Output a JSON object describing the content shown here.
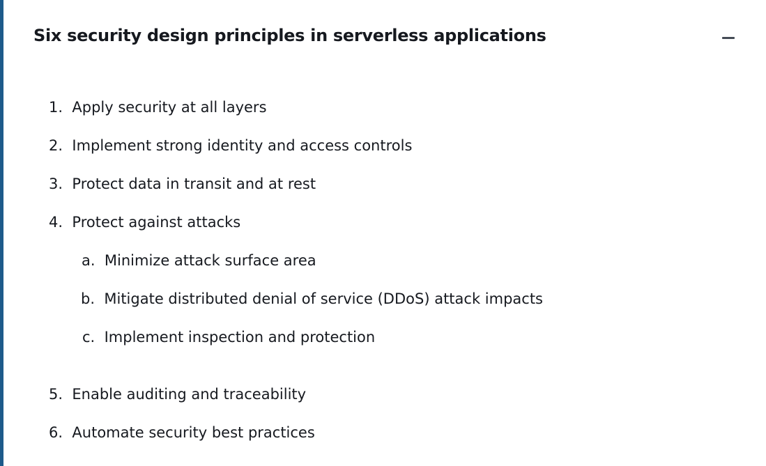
{
  "panel": {
    "title": "Six security design principles in serverless applications",
    "collapse_icon": "minus-icon"
  },
  "principles": [
    {
      "marker": "1.",
      "text": "Apply security at all layers"
    },
    {
      "marker": "2.",
      "text": "Implement strong identity and access controls"
    },
    {
      "marker": "3.",
      "text": "Protect data in transit and at rest"
    },
    {
      "marker": "4.",
      "text": "Protect against attacks"
    },
    {
      "marker": "5.",
      "text": "Enable auditing and traceability"
    },
    {
      "marker": "6.",
      "text": "Automate security best practices"
    }
  ],
  "sub_principles": [
    {
      "marker": "a.",
      "text": "Minimize attack surface area"
    },
    {
      "marker": "b.",
      "text": "Mitigate distributed denial of service (DDoS) attack impacts"
    },
    {
      "marker": "c.",
      "text": "Implement inspection and protection"
    }
  ],
  "colors": {
    "accent": "#1d5a8a",
    "text": "#16191f"
  }
}
